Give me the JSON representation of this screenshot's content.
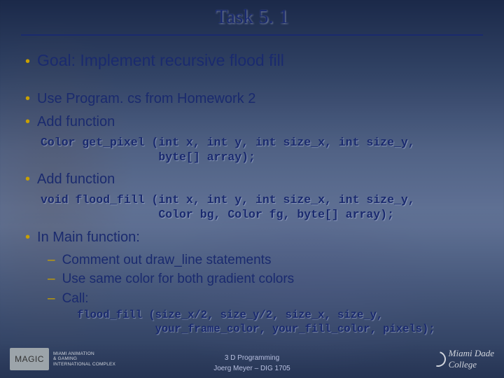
{
  "title": "Task 5. 1",
  "goal": "Goal: Implement recursive flood fill",
  "b1": "Use Program. cs from Homework 2",
  "b2": "Add function",
  "code1": "Color get_pixel (int x, int y, int size_x, int size_y,\n                 byte[] array);",
  "b3": "Add function",
  "code2": "void flood_fill (int x, int y, int size_x, int size_y,\n                 Color bg, Color fg, byte[] array);",
  "b4": "In Main function:",
  "s1": "Comment out draw_line statements",
  "s2": "Use same color for both gradient colors",
  "s3_prefix": "Call: ",
  "code3": "flood_fill (size_x/2, size_y/2, size_x, size_y,\n            your_frame_color, your_fill_color, pixels);",
  "footer": {
    "line1": "3 D Programming",
    "line2": "Joerg Meyer – DIG 1705",
    "magic": "MAGIC",
    "magtag": "MIAMI ANIMATION\n& GAMING\nINTERNATIONAL COMPLEX",
    "mdc": "Miami Dade\nCollege"
  }
}
